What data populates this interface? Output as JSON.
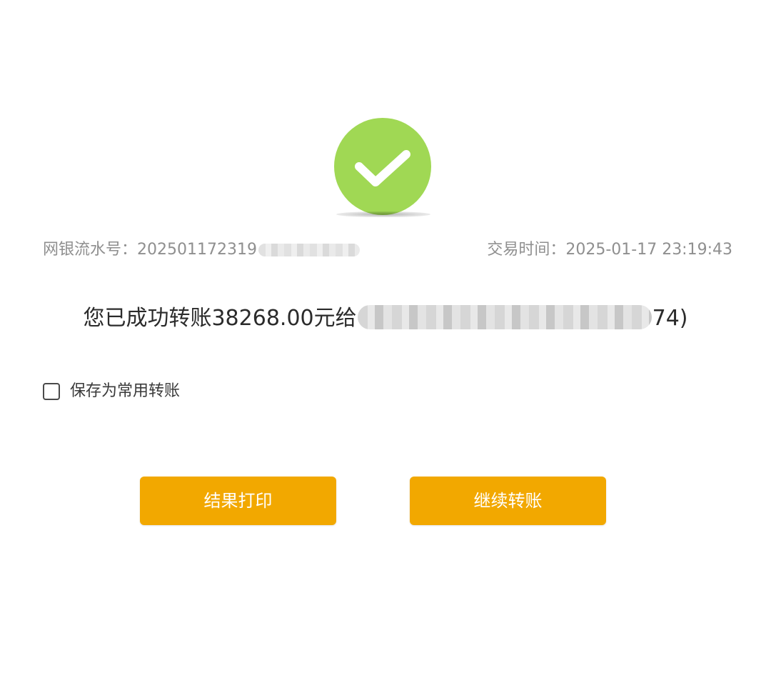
{
  "status_icon": {
    "name": "check-circle-icon",
    "color": "#a0d854"
  },
  "serial": {
    "label": "网银流水号：",
    "value_visible": "202501172319"
  },
  "transaction_time": {
    "label": "交易时间：",
    "value": "2025-01-17 23:19:43"
  },
  "message": {
    "prefix": "您已成功转账38268.00元给",
    "suffix": "74)"
  },
  "save_option": {
    "label": "保存为常用转账",
    "checked": false
  },
  "buttons": {
    "print_label": "结果打印",
    "continue_label": "继续转账",
    "color": "#f2a800"
  }
}
